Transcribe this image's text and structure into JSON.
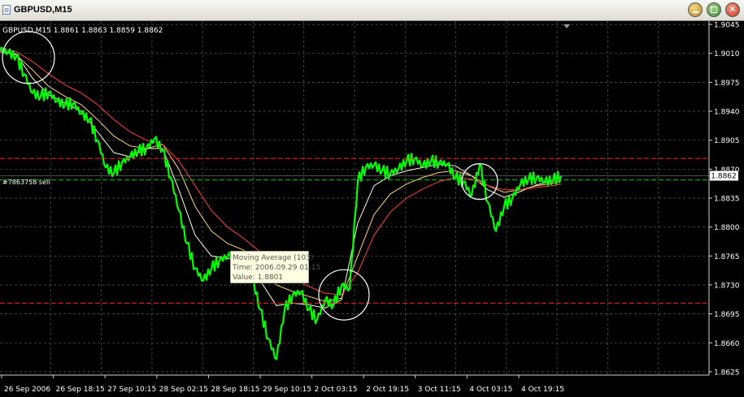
{
  "window": {
    "title": "GBPUSD,M15",
    "icon": "chart-window-icon"
  },
  "controls": [
    "minimize-icon",
    "maximize-icon",
    "close-icon"
  ],
  "colors": {
    "background": "#000000",
    "grid": "#5a5a5a",
    "price_line": "#00ff00",
    "ma_fast": "#ffffe0",
    "ma_mid": "#ffd27f",
    "ma_slow": "#ff4040",
    "order_line": "#00cc00",
    "sr_line": "#ff2020"
  },
  "chart_data": {
    "type": "line",
    "symbol_info": "GBPUSD,M15  1.8861 1.8863 1.8859 1.8862",
    "y_ticks": [
      "1.9045",
      "1.9010",
      "1.8975",
      "1.8940",
      "1.8905",
      "1.8870",
      "1.8835",
      "1.8800",
      "1.8765",
      "1.8730",
      "1.8695",
      "1.8660",
      "1.8625"
    ],
    "y_tick_values": [
      1.9045,
      1.901,
      1.8975,
      1.894,
      1.8905,
      1.887,
      1.8835,
      1.88,
      1.8765,
      1.873,
      1.8695,
      1.866,
      1.8625
    ],
    "ylim": [
      1.8621,
      1.9049
    ],
    "x_ticks": [
      "26 Sep 2006",
      "26 Sep 18:15",
      "27 Sep 10:15",
      "28 Sep 02:15",
      "28 Sep 18:15",
      "29 Sep 10:15",
      "2 Oct 03:15",
      "2 Oct 19:15",
      "3 Oct 11:15",
      "4 Oct 03:15",
      "4 Oct 19:15"
    ],
    "current_price": "1.8862",
    "current_price_value": 1.8862,
    "order_label": "#7863758 sell",
    "order_price": 1.8857,
    "resistance": 1.8883,
    "support": 1.8708,
    "series": [
      {
        "role": "price",
        "x": [
          0,
          10,
          20,
          30,
          40,
          50,
          60,
          70,
          80,
          90,
          100,
          110,
          120,
          130,
          140,
          150,
          160,
          170,
          180,
          190,
          200,
          210,
          220,
          230,
          240,
          250,
          260,
          270,
          280,
          290,
          300,
          310,
          320,
          330,
          340,
          350,
          360,
          370,
          380,
          390,
          400,
          410,
          420,
          430,
          440,
          450,
          460,
          470,
          480,
          490,
          500,
          510,
          520,
          530,
          540,
          550,
          560,
          570,
          580,
          590,
          600,
          610,
          620,
          630,
          640,
          650,
          660,
          670,
          680,
          690
        ],
        "values": [
          1.9015,
          1.9011,
          1.9006,
          1.8985,
          1.8962,
          1.8958,
          1.8963,
          1.8952,
          1.8948,
          1.895,
          1.8937,
          1.893,
          1.8905,
          1.8872,
          1.8865,
          1.8878,
          1.8885,
          1.8892,
          1.8895,
          1.8907,
          1.8893,
          1.886,
          1.882,
          1.878,
          1.875,
          1.8735,
          1.875,
          1.876,
          1.8765,
          1.8761,
          1.8765,
          1.874,
          1.87,
          1.8665,
          1.864,
          1.87,
          1.8718,
          1.8722,
          1.87,
          1.8688,
          1.8712,
          1.8705,
          1.873,
          1.8725,
          1.8856,
          1.8873,
          1.8875,
          1.8868,
          1.8865,
          1.887,
          1.888,
          1.8883,
          1.8874,
          1.888,
          1.8878,
          1.8876,
          1.886,
          1.8855,
          1.8838,
          1.8876,
          1.883,
          1.8795,
          1.8825,
          1.8835,
          1.8852,
          1.8858,
          1.886,
          1.8855,
          1.8857,
          1.8862
        ]
      },
      {
        "role": "ma-fast",
        "x": [
          0,
          20,
          40,
          60,
          80,
          100,
          120,
          140,
          160,
          180,
          200,
          220,
          240,
          260,
          280,
          300,
          320,
          340,
          360,
          380,
          400,
          420,
          440,
          460,
          480,
          500,
          520,
          540,
          560,
          580,
          600,
          620,
          640,
          660,
          680,
          690
        ],
        "values": [
          1.9014,
          1.9009,
          1.898,
          1.896,
          1.895,
          1.894,
          1.8915,
          1.889,
          1.8885,
          1.8895,
          1.8895,
          1.8845,
          1.879,
          1.8765,
          1.8762,
          1.876,
          1.8735,
          1.8705,
          1.8708,
          1.8706,
          1.8702,
          1.8712,
          1.8805,
          1.885,
          1.8862,
          1.8868,
          1.8872,
          1.8876,
          1.8874,
          1.8862,
          1.8845,
          1.8836,
          1.8843,
          1.8851,
          1.8856,
          1.8859
        ]
      },
      {
        "role": "ma-mid",
        "x": [
          0,
          20,
          40,
          60,
          80,
          100,
          120,
          140,
          160,
          180,
          200,
          220,
          240,
          260,
          280,
          300,
          320,
          340,
          360,
          380,
          400,
          420,
          440,
          460,
          480,
          500,
          520,
          540,
          560,
          580,
          600,
          620,
          640,
          660,
          680,
          690
        ],
        "values": [
          1.9012,
          1.9008,
          1.899,
          1.897,
          1.8958,
          1.8948,
          1.893,
          1.891,
          1.8898,
          1.8895,
          1.89,
          1.887,
          1.8825,
          1.8795,
          1.878,
          1.8772,
          1.8755,
          1.873,
          1.8722,
          1.8716,
          1.871,
          1.8714,
          1.8765,
          1.8815,
          1.884,
          1.8852,
          1.886,
          1.8866,
          1.8868,
          1.8862,
          1.885,
          1.8842,
          1.8845,
          1.885,
          1.8853,
          1.8856
        ]
      },
      {
        "role": "ma-slow",
        "x": [
          0,
          20,
          40,
          60,
          80,
          100,
          120,
          140,
          160,
          180,
          200,
          220,
          240,
          260,
          280,
          300,
          320,
          340,
          360,
          380,
          400,
          420,
          440,
          460,
          480,
          500,
          520,
          540,
          560,
          580,
          600,
          620,
          640,
          660,
          680,
          690
        ],
        "values": [
          1.9016,
          1.9012,
          1.9,
          1.8985,
          1.8972,
          1.8962,
          1.8948,
          1.893,
          1.8915,
          1.8905,
          1.89,
          1.888,
          1.885,
          1.882,
          1.88,
          1.8786,
          1.877,
          1.875,
          1.8738,
          1.8728,
          1.872,
          1.8718,
          1.8745,
          1.879,
          1.8818,
          1.8835,
          1.8846,
          1.8855,
          1.886,
          1.8858,
          1.885,
          1.8845,
          1.8845,
          1.8848,
          1.885,
          1.8852
        ]
      }
    ],
    "tooltip": {
      "title": "Moving Average (103)",
      "time": "Time: 2006.09.29 01:15",
      "value": "Value: 1.8801"
    },
    "highlights": [
      {
        "x": 35,
        "y": 1.9005
      },
      {
        "x": 423,
        "y": 1.8718
      },
      {
        "x": 590,
        "y": 1.8855
      }
    ]
  }
}
